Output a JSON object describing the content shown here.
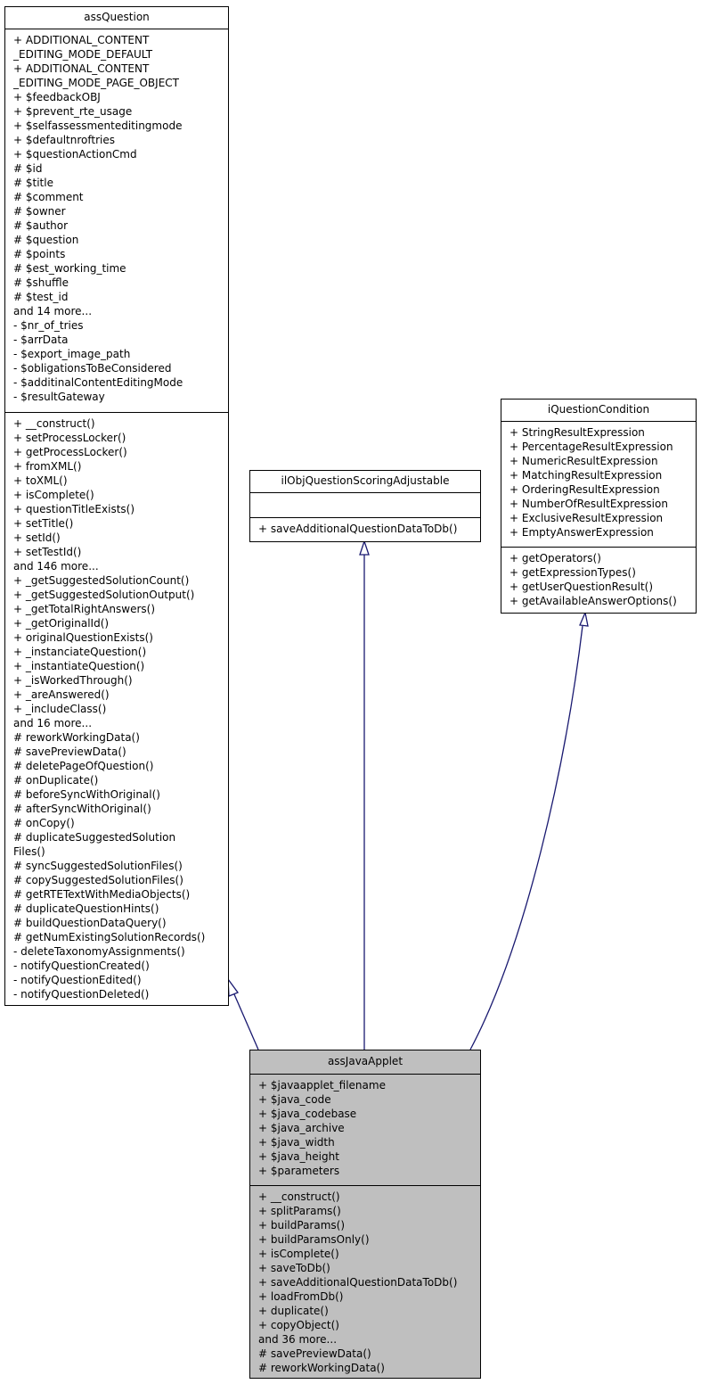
{
  "diagram": {
    "type": "uml-class-inheritance",
    "edge_color": "#191970",
    "focus_fill": "#bfbfbf"
  },
  "classes": {
    "assQuestion": {
      "name": "assQuestion",
      "attributes": [
        "+ ADDITIONAL_CONTENT",
        "_EDITING_MODE_DEFAULT",
        "+ ADDITIONAL_CONTENT",
        "_EDITING_MODE_PAGE_OBJECT",
        "+ $feedbackOBJ",
        "+ $prevent_rte_usage",
        "+ $selfassessmenteditingmode",
        "+ $defaultnroftries",
        "+ $questionActionCmd",
        "# $id",
        "# $title",
        "# $comment",
        "# $owner",
        "# $author",
        "# $question",
        "# $points",
        "# $est_working_time",
        "# $shuffle",
        "# $test_id",
        "and 14 more...",
        "- $nr_of_tries",
        "- $arrData",
        "- $export_image_path",
        "- $obligationsToBeConsidered",
        "- $additinalContentEditingMode",
        "- $resultGateway"
      ],
      "methods": [
        "+ __construct()",
        "+ setProcessLocker()",
        "+ getProcessLocker()",
        "+ fromXML()",
        "+ toXML()",
        "+ isComplete()",
        "+ questionTitleExists()",
        "+ setTitle()",
        "+ setId()",
        "+ setTestId()",
        "and 146 more...",
        "+ _getSuggestedSolutionCount()",
        "+ _getSuggestedSolutionOutput()",
        "+ _getTotalRightAnswers()",
        "+ _getOriginalId()",
        "+ originalQuestionExists()",
        "+ _instanciateQuestion()",
        "+ _instantiateQuestion()",
        "+ _isWorkedThrough()",
        "+ _areAnswered()",
        "+ _includeClass()",
        "and 16 more...",
        "# reworkWorkingData()",
        "# savePreviewData()",
        "# deletePageOfQuestion()",
        "# onDuplicate()",
        "# beforeSyncWithOriginal()",
        "# afterSyncWithOriginal()",
        "# onCopy()",
        "# duplicateSuggestedSolution",
        "Files()",
        "# syncSuggestedSolutionFiles()",
        "# copySuggestedSolutionFiles()",
        "# getRTETextWithMediaObjects()",
        "# duplicateQuestionHints()",
        "# buildQuestionDataQuery()",
        "# getNumExistingSolutionRecords()",
        "- deleteTaxonomyAssignments()",
        "- notifyQuestionCreated()",
        "- notifyQuestionEdited()",
        "- notifyQuestionDeleted()"
      ]
    },
    "ilObjQuestionScoringAdjustable": {
      "name": "ilObjQuestionScoringAdjustable",
      "attributes": [],
      "methods": [
        "+ saveAdditionalQuestionDataToDb()"
      ]
    },
    "iQuestionCondition": {
      "name": "iQuestionCondition",
      "attributes": [
        "+ StringResultExpression",
        "+ PercentageResultExpression",
        "+ NumericResultExpression",
        "+ MatchingResultExpression",
        "+ OrderingResultExpression",
        "+ NumberOfResultExpression",
        "+ ExclusiveResultExpression",
        "+ EmptyAnswerExpression"
      ],
      "methods": [
        "+ getOperators()",
        "+ getExpressionTypes()",
        "+ getUserQuestionResult()",
        "+ getAvailableAnswerOptions()"
      ]
    },
    "assJavaApplet": {
      "name": "assJavaApplet",
      "attributes": [
        "+ $javaapplet_filename",
        "+ $java_code",
        "+ $java_codebase",
        "+ $java_archive",
        "+ $java_width",
        "+ $java_height",
        "+ $parameters"
      ],
      "methods": [
        "+ __construct()",
        "+ splitParams()",
        "+ buildParams()",
        "+ buildParamsOnly()",
        "+ isComplete()",
        "+ saveToDb()",
        "+ saveAdditionalQuestionDataToDb()",
        "+ loadFromDb()",
        "+ duplicate()",
        "+ copyObject()",
        "and 36 more...",
        "# savePreviewData()",
        "# reworkWorkingData()"
      ]
    }
  },
  "relations": [
    {
      "from": "assJavaApplet",
      "to": "assQuestion",
      "kind": "generalization"
    },
    {
      "from": "assJavaApplet",
      "to": "ilObjQuestionScoringAdjustable",
      "kind": "realization"
    },
    {
      "from": "assJavaApplet",
      "to": "iQuestionCondition",
      "kind": "realization"
    }
  ]
}
